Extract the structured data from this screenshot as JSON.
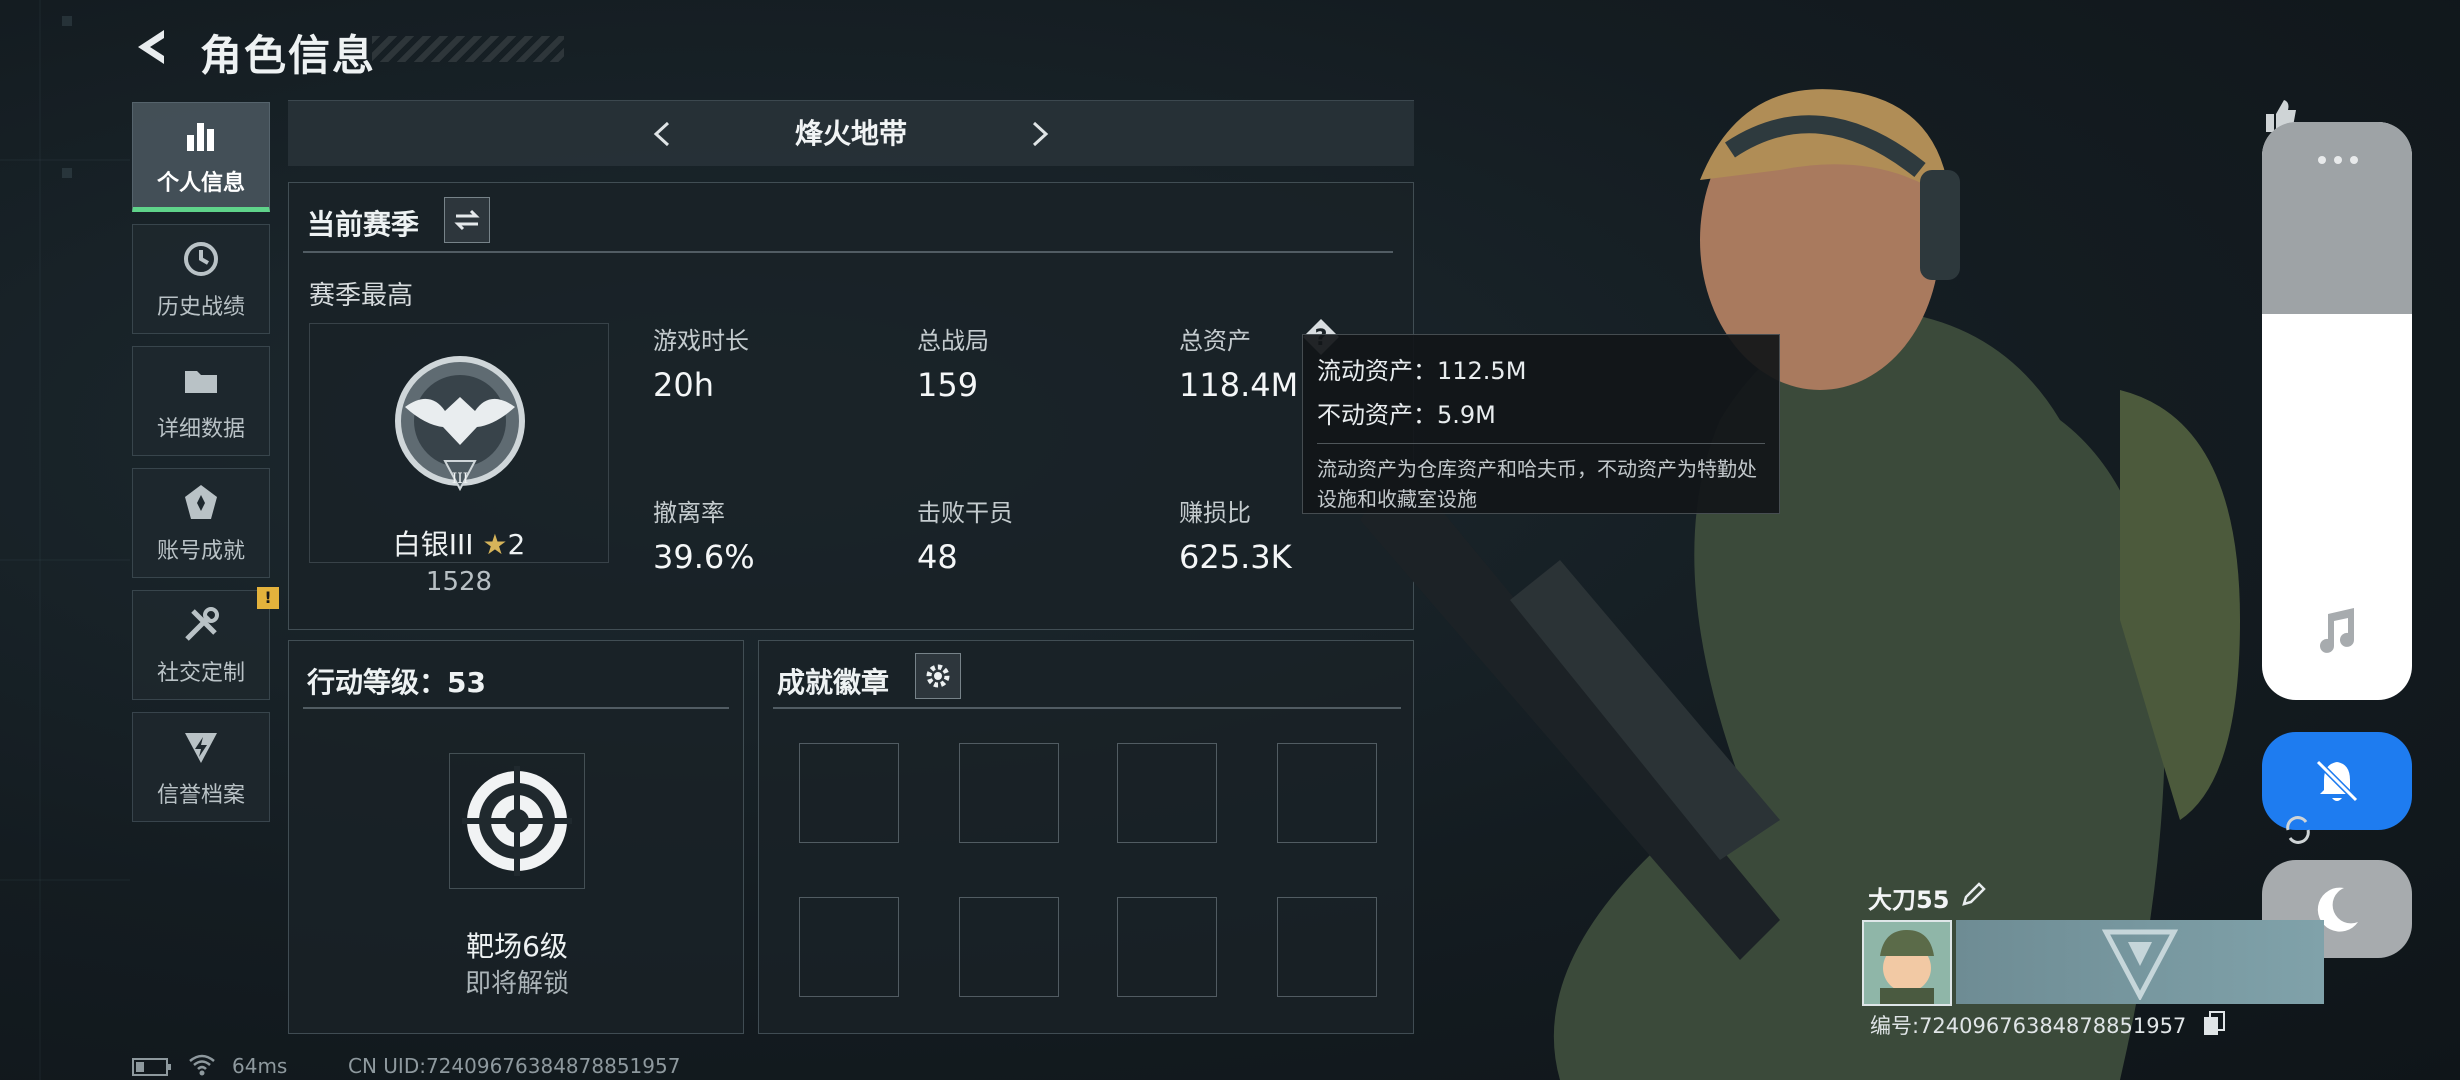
{
  "header": {
    "title": "角色信息"
  },
  "sidebar": {
    "items": [
      {
        "label": "个人信息",
        "icon": "bar-chart-icon",
        "active": true
      },
      {
        "label": "历史战绩",
        "icon": "history-icon"
      },
      {
        "label": "详细数据",
        "icon": "folder-icon"
      },
      {
        "label": "账号成就",
        "icon": "achievement-icon"
      },
      {
        "label": "社交定制",
        "icon": "tools-icon",
        "badge": "!"
      },
      {
        "label": "信誉档案",
        "icon": "credit-icon"
      }
    ]
  },
  "mode_bar": {
    "title": "烽火地带"
  },
  "season": {
    "title": "当前赛季",
    "subtitle": "赛季最高",
    "rank_name": "白银III",
    "rank_stars": "2",
    "rank_score": "1528",
    "rank_numeral": "III",
    "stats": [
      {
        "label": "游戏时长",
        "value": "20h"
      },
      {
        "label": "总战局",
        "value": "159"
      },
      {
        "label": "总资产",
        "value": "118.4M"
      },
      {
        "label": "撤离率",
        "value": "39.6%"
      },
      {
        "label": "击败干员",
        "value": "48"
      },
      {
        "label": "赚损比",
        "value": "625.3K"
      }
    ]
  },
  "tooltip": {
    "line1": "流动资产：112.5M",
    "line2": "不动资产：5.9M",
    "desc": "流动资产为仓库资产和哈夫币，不动资产为特勤处设施和收藏室设施"
  },
  "level": {
    "title": "行动等级：53",
    "item_name": "靶场6级",
    "item_status": "即将解锁"
  },
  "badges": {
    "title": "成就徽章"
  },
  "player": {
    "name": "大刀55",
    "id": "编号:7240967638487885​1957"
  },
  "footer": {
    "ping": "64ms",
    "uid": "CN UID:7240967638487885​1957"
  },
  "colors": {
    "accent_green": "#5fd38a",
    "dnd_blue": "#1e7cf0",
    "warning": "#e3b23c"
  }
}
